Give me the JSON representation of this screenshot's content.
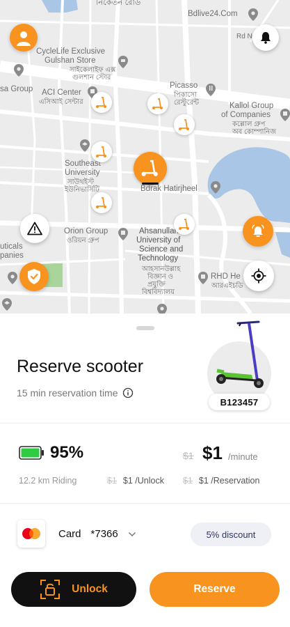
{
  "map": {
    "labels": {
      "bdlive": "Bdlive24.Com",
      "rdno": "Rd No",
      "cyclelife_en": "CycleLife Exclusive",
      "cyclelife_en2": "Gulshan Store",
      "cyclelife_bn": "সাইকেলাইফ এক্স",
      "cyclelife_bn2": "গুলশান স্টোর",
      "sagroup": "sa Group",
      "aci_en": "ACI Center",
      "aci_bn": "এসিআই সেন্টার",
      "picasso_en": "Picasso",
      "picasso_bn": "পিকাসো",
      "picasso_bn2": "রেস্টুরেন্ট",
      "kallol_en": "Kallol Group",
      "kallol_en2": "of Companies",
      "kallol_bn": "কল্লোল গ্রুপ",
      "kallol_bn2": "অব কোম্পানিজ",
      "southeast_en": "Southeast",
      "southeast_en2": "University",
      "southeast_bn": "সাউথইস্ট",
      "southeast_bn2": "ইউনিভার্সিটি",
      "bdrak": "Bdrak Hatirjheel",
      "orion_en": "Orion Group",
      "orion_bn": "ওরিয়ন গ্রুপ",
      "ahsan1": "Ahsanullah",
      "ahsan2": "University of",
      "ahsan3": "Science and",
      "ahsan4": "Technology",
      "ahsan_bn1": "আহসানউল্লাহ",
      "ahsan_bn2": "বিজ্ঞান ও",
      "ahsan_bn3": "প্রযুক্তি",
      "ahsan_bn4": "বিশ্ববিদ্যালয়",
      "uticals": "uticals",
      "panies": "panies",
      "rhd": "RHD He",
      "rhd_bn": "আরএইচডি",
      "top_bn": "নিকেতন রোড"
    }
  },
  "sheet": {
    "title": "Reserve scooter",
    "reservation_time": "15 min reservation time",
    "scooter_id": "B123457",
    "battery_percent": "95%",
    "riding_range": "12.2 km Riding",
    "price_old": "$1",
    "price": "$1",
    "price_unit": "/minute",
    "unlock_fee_old": "$1",
    "unlock_fee": "$1 /Unlock",
    "reservation_fee_old": "$1",
    "reservation_fee": "$1 /Reservation",
    "card_label": "Card",
    "card_number": "*7366",
    "discount": "5% discount",
    "unlock_button": "Unlock",
    "reserve_button": "Reserve"
  },
  "colors": {
    "accent": "#f7931e",
    "dark": "#111111",
    "battery": "#2ecc40",
    "water": "#aac6e6"
  }
}
